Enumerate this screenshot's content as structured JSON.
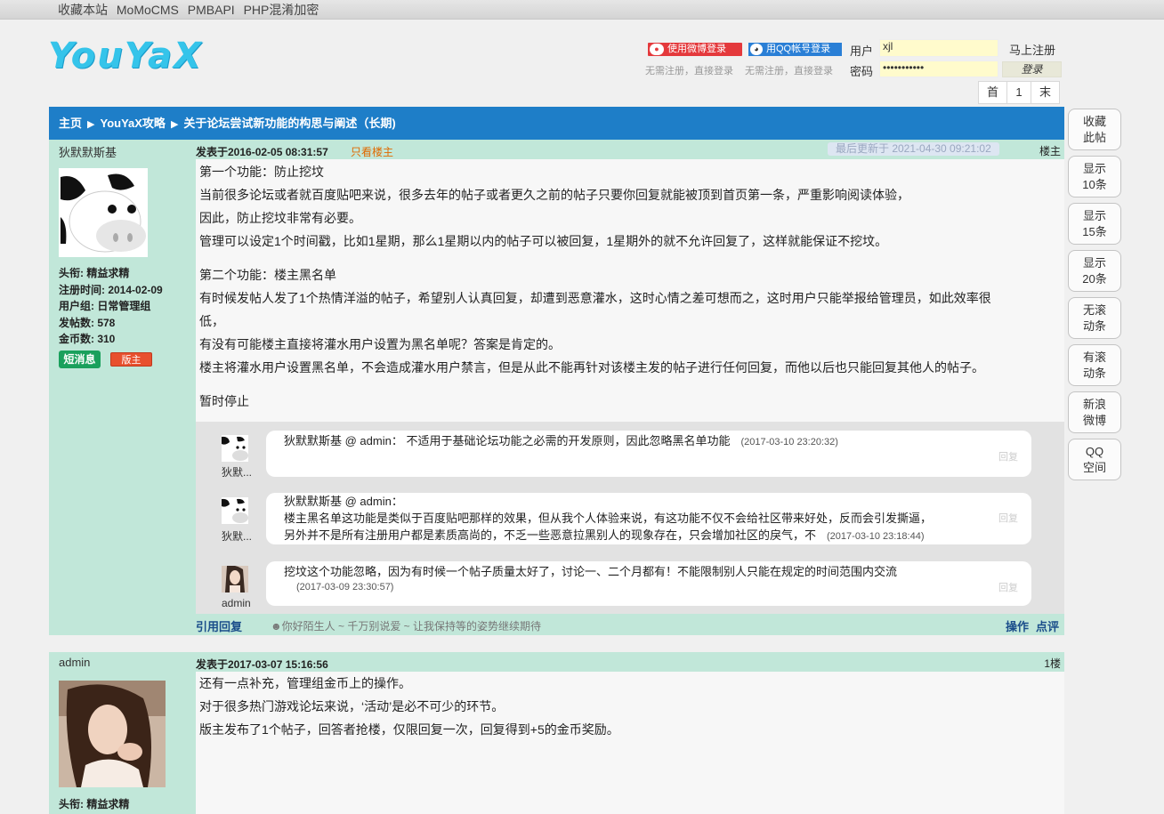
{
  "topbar": {
    "links": [
      "收藏本站",
      "MoMoCMS",
      "PMBAPI",
      "PHP混淆加密"
    ]
  },
  "header": {
    "logo": "YouYaX",
    "weibo_login": "使用微博登录",
    "qq_login": "用QQ帐号登录",
    "weibo_hint": "无需注册，直接登录",
    "qq_hint": "无需注册，直接登录",
    "user_label": "用户",
    "pass_label": "密码",
    "user_value": "xjl",
    "pass_value": "•••••••••••",
    "register": "马上注册",
    "login": "登录"
  },
  "pager": {
    "first": "首",
    "page": "1",
    "last": "末"
  },
  "breadcrumb": {
    "home": "主页",
    "section": "YouYaX攻略",
    "topic": "关于论坛尝试新功能的构思与阐述（长期)"
  },
  "sidebar": [
    "收藏\n此帖",
    "显示\n10条",
    "显示\n15条",
    "显示\n20条",
    "无滚\n动条",
    "有滚\n动条",
    "新浪\n微博",
    "QQ\n空间"
  ],
  "post1": {
    "author": "狄默默斯基",
    "stats": [
      "头衔:  精益求精",
      "注册时间:  2014-02-09",
      "用户组:  日常管理组",
      "发帖数:  578",
      "金币数:  310"
    ],
    "msg_btn": "短消息",
    "mod_badge": "版主",
    "date": "发表于2016-02-05 08:31:57",
    "only_op": "只看楼主",
    "updated": "最后更新于 2021-04-30 09:21:02",
    "floor": "楼主",
    "lines_a": [
      "第一个功能：防止挖坟",
      "当前很多论坛或者就百度贴吧来说，很多去年的帖子或者更久之前的帖子只要你回复就能被顶到首页第一条，严重影响阅读体验，",
      "因此，防止挖坟非常有必要。",
      "管理可以设定1个时间戳，比如1星期，那么1星期以内的帖子可以被回复，1星期外的就不允许回复了，这样就能保证不挖坟。"
    ],
    "lines_b": [
      "第二个功能：楼主黑名单",
      "有时候发帖人发了1个热情洋溢的帖子，希望别人认真回复，却遭到恶意灌水，这时心情之差可想而之，这时用户只能举报给管理员，如此效率很",
      "低，",
      "有没有可能楼主直接将灌水用户设置为黑名单呢？答案是肯定的。",
      "楼主将灌水用户设置黑名单，不会造成灌水用户禁言，但是从此不能再针对该楼主发的帖子进行任何回复，而他以后也只能回复其他人的帖子。"
    ],
    "line_c": "暂时停止",
    "replies": [
      {
        "name": "狄默...",
        "line1": "狄默默斯基 @ admin：  不适用于基础论坛功能之必需的开发原则，因此忽略黑名单功能",
        "line2": "",
        "line3": "",
        "time": "(2017-03-10 23:20:32)",
        "reply": "回复"
      },
      {
        "name": "狄默...",
        "line1": "狄默默斯基 @ admin：",
        "line2": "楼主黑名单这功能是类似于百度贴吧那样的效果，但从我个人体验来说，有这功能不仅不会给社区带来好处，反而会引发撕逼，",
        "line3": "另外并不是所有注册用户都是素质高尚的，不乏一些恶意拉黑别人的现象存在，只会增加社区的戾气，不",
        "time": "(2017-03-10 23:18:44)",
        "reply": "回复"
      },
      {
        "name": "admin",
        "line1": "挖坟这个功能忽略，因为有时候一个帖子质量太好了，讨论一、二个月都有！不能限制别人只能在规定的时间范围内交流",
        "line2": "",
        "line3": "",
        "time": "(2017-03-09 23:30:57)",
        "reply": "回复"
      }
    ],
    "quote": "引用回复",
    "signature": "你好陌生人 ~ 千万别说爱 ~ 让我保持等的姿势继续期待",
    "op_action": "操作",
    "op_rate": "点评"
  },
  "post2": {
    "author": "admin",
    "stats": [
      "头衔:  精益求精"
    ],
    "date": "发表于2017-03-07 15:16:56",
    "floor": "1楼",
    "lines": [
      "还有一点补充，管理组金币上的操作。",
      "对于很多热门游戏论坛来说，‘活动’是必不可少的环节。",
      "版主发布了1个帖子，回答者抢楼，仅限回复一次，回复得到+5的金币奖励。"
    ]
  },
  "colors": {
    "accent": "#1e7ec8",
    "post_bg": "#c1e7d9",
    "content_bg": "#f7f7f7"
  }
}
